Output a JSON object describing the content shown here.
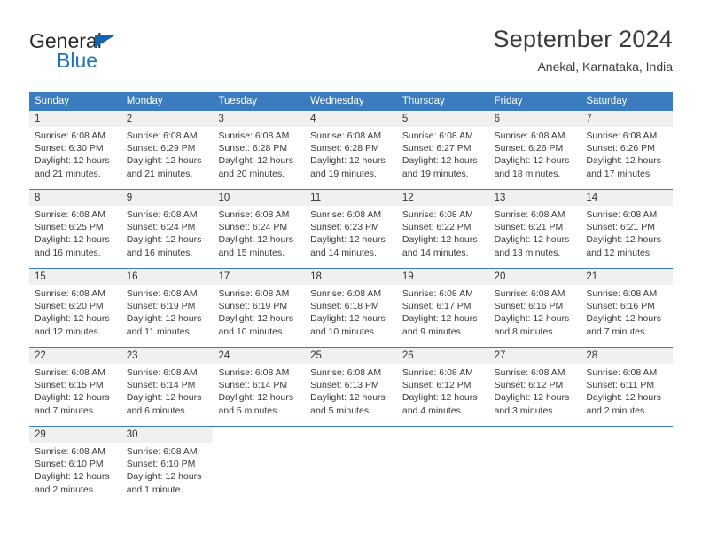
{
  "brand": {
    "name_part1": "General",
    "name_part2": "Blue",
    "triangle_icon": "brand-triangle-icon",
    "accent_color": "#1165ad"
  },
  "header": {
    "title": "September 2024",
    "location": "Anekal, Karnataka, India"
  },
  "theme": {
    "header_blue": "#3a7cbe",
    "daynum_band": "#f0f0f0",
    "text": "#3a3a3a"
  },
  "weekdays": [
    "Sunday",
    "Monday",
    "Tuesday",
    "Wednesday",
    "Thursday",
    "Friday",
    "Saturday"
  ],
  "weeks": [
    [
      {
        "day": "1",
        "lines": [
          "Sunrise: 6:08 AM",
          "Sunset: 6:30 PM",
          "Daylight: 12 hours",
          "and 21 minutes."
        ]
      },
      {
        "day": "2",
        "lines": [
          "Sunrise: 6:08 AM",
          "Sunset: 6:29 PM",
          "Daylight: 12 hours",
          "and 21 minutes."
        ]
      },
      {
        "day": "3",
        "lines": [
          "Sunrise: 6:08 AM",
          "Sunset: 6:28 PM",
          "Daylight: 12 hours",
          "and 20 minutes."
        ]
      },
      {
        "day": "4",
        "lines": [
          "Sunrise: 6:08 AM",
          "Sunset: 6:28 PM",
          "Daylight: 12 hours",
          "and 19 minutes."
        ]
      },
      {
        "day": "5",
        "lines": [
          "Sunrise: 6:08 AM",
          "Sunset: 6:27 PM",
          "Daylight: 12 hours",
          "and 19 minutes."
        ]
      },
      {
        "day": "6",
        "lines": [
          "Sunrise: 6:08 AM",
          "Sunset: 6:26 PM",
          "Daylight: 12 hours",
          "and 18 minutes."
        ]
      },
      {
        "day": "7",
        "lines": [
          "Sunrise: 6:08 AM",
          "Sunset: 6:26 PM",
          "Daylight: 12 hours",
          "and 17 minutes."
        ]
      }
    ],
    [
      {
        "day": "8",
        "lines": [
          "Sunrise: 6:08 AM",
          "Sunset: 6:25 PM",
          "Daylight: 12 hours",
          "and 16 minutes."
        ]
      },
      {
        "day": "9",
        "lines": [
          "Sunrise: 6:08 AM",
          "Sunset: 6:24 PM",
          "Daylight: 12 hours",
          "and 16 minutes."
        ]
      },
      {
        "day": "10",
        "lines": [
          "Sunrise: 6:08 AM",
          "Sunset: 6:24 PM",
          "Daylight: 12 hours",
          "and 15 minutes."
        ]
      },
      {
        "day": "11",
        "lines": [
          "Sunrise: 6:08 AM",
          "Sunset: 6:23 PM",
          "Daylight: 12 hours",
          "and 14 minutes."
        ]
      },
      {
        "day": "12",
        "lines": [
          "Sunrise: 6:08 AM",
          "Sunset: 6:22 PM",
          "Daylight: 12 hours",
          "and 14 minutes."
        ]
      },
      {
        "day": "13",
        "lines": [
          "Sunrise: 6:08 AM",
          "Sunset: 6:21 PM",
          "Daylight: 12 hours",
          "and 13 minutes."
        ]
      },
      {
        "day": "14",
        "lines": [
          "Sunrise: 6:08 AM",
          "Sunset: 6:21 PM",
          "Daylight: 12 hours",
          "and 12 minutes."
        ]
      }
    ],
    [
      {
        "day": "15",
        "lines": [
          "Sunrise: 6:08 AM",
          "Sunset: 6:20 PM",
          "Daylight: 12 hours",
          "and 12 minutes."
        ]
      },
      {
        "day": "16",
        "lines": [
          "Sunrise: 6:08 AM",
          "Sunset: 6:19 PM",
          "Daylight: 12 hours",
          "and 11 minutes."
        ]
      },
      {
        "day": "17",
        "lines": [
          "Sunrise: 6:08 AM",
          "Sunset: 6:19 PM",
          "Daylight: 12 hours",
          "and 10 minutes."
        ]
      },
      {
        "day": "18",
        "lines": [
          "Sunrise: 6:08 AM",
          "Sunset: 6:18 PM",
          "Daylight: 12 hours",
          "and 10 minutes."
        ]
      },
      {
        "day": "19",
        "lines": [
          "Sunrise: 6:08 AM",
          "Sunset: 6:17 PM",
          "Daylight: 12 hours",
          "and 9 minutes."
        ]
      },
      {
        "day": "20",
        "lines": [
          "Sunrise: 6:08 AM",
          "Sunset: 6:16 PM",
          "Daylight: 12 hours",
          "and 8 minutes."
        ]
      },
      {
        "day": "21",
        "lines": [
          "Sunrise: 6:08 AM",
          "Sunset: 6:16 PM",
          "Daylight: 12 hours",
          "and 7 minutes."
        ]
      }
    ],
    [
      {
        "day": "22",
        "lines": [
          "Sunrise: 6:08 AM",
          "Sunset: 6:15 PM",
          "Daylight: 12 hours",
          "and 7 minutes."
        ]
      },
      {
        "day": "23",
        "lines": [
          "Sunrise: 6:08 AM",
          "Sunset: 6:14 PM",
          "Daylight: 12 hours",
          "and 6 minutes."
        ]
      },
      {
        "day": "24",
        "lines": [
          "Sunrise: 6:08 AM",
          "Sunset: 6:14 PM",
          "Daylight: 12 hours",
          "and 5 minutes."
        ]
      },
      {
        "day": "25",
        "lines": [
          "Sunrise: 6:08 AM",
          "Sunset: 6:13 PM",
          "Daylight: 12 hours",
          "and 5 minutes."
        ]
      },
      {
        "day": "26",
        "lines": [
          "Sunrise: 6:08 AM",
          "Sunset: 6:12 PM",
          "Daylight: 12 hours",
          "and 4 minutes."
        ]
      },
      {
        "day": "27",
        "lines": [
          "Sunrise: 6:08 AM",
          "Sunset: 6:12 PM",
          "Daylight: 12 hours",
          "and 3 minutes."
        ]
      },
      {
        "day": "28",
        "lines": [
          "Sunrise: 6:08 AM",
          "Sunset: 6:11 PM",
          "Daylight: 12 hours",
          "and 2 minutes."
        ]
      }
    ],
    [
      {
        "day": "29",
        "lines": [
          "Sunrise: 6:08 AM",
          "Sunset: 6:10 PM",
          "Daylight: 12 hours",
          "and 2 minutes."
        ]
      },
      {
        "day": "30",
        "lines": [
          "Sunrise: 6:08 AM",
          "Sunset: 6:10 PM",
          "Daylight: 12 hours",
          "and 1 minute."
        ]
      },
      {
        "day": "",
        "lines": []
      },
      {
        "day": "",
        "lines": []
      },
      {
        "day": "",
        "lines": []
      },
      {
        "day": "",
        "lines": []
      },
      {
        "day": "",
        "lines": []
      }
    ]
  ]
}
